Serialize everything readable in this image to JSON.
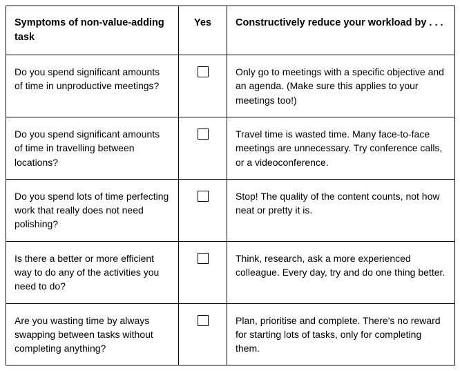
{
  "headers": {
    "symptom": "Symptoms of non-value-adding task",
    "yes": "Yes",
    "reduce": "Constructively reduce your workload by . . ."
  },
  "rows": [
    {
      "symptom": "Do you spend significant amounts of time in unproductive meetings?",
      "reduce": "Only go to meetings with a specific objective and an agenda. (Make sure this applies to your meetings too!)"
    },
    {
      "symptom": "Do you spend significant amounts of time in travelling between locations?",
      "reduce": "Travel time is wasted time. Many face-to-face meetings are unnecessary. Try conference calls, or a videoconference."
    },
    {
      "symptom": "Do you spend lots of time perfecting work that really does not need polishing?",
      "reduce": "Stop! The quality of the content counts, not how neat or pretty it is."
    },
    {
      "symptom": "Is there a better or more efficient way to do any of the activities you need to do?",
      "reduce": "Think, research, ask a more experienced colleague. Every day, try and do one thing better."
    },
    {
      "symptom": "Are you wasting time by always swapping between tasks without completing anything?",
      "reduce": "Plan, prioritise and complete. There's no reward for starting lots of tasks, only for completing them."
    }
  ]
}
